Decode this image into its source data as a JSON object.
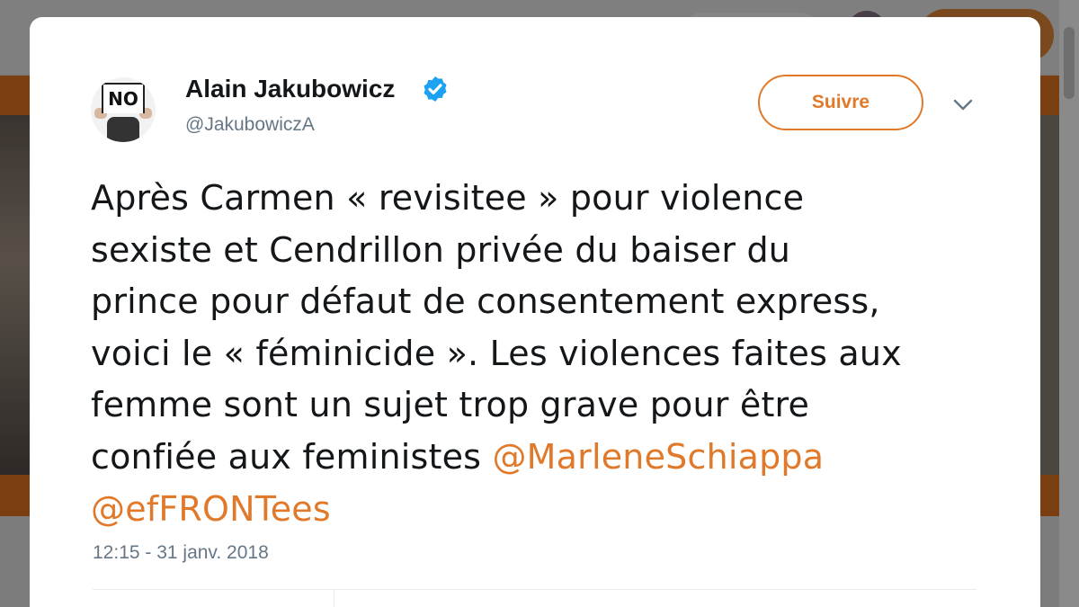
{
  "tweet": {
    "author": {
      "display_name": "Alain Jakubowicz",
      "handle": "@JakubowiczA",
      "verified": true,
      "avatar_sign_text": "NO"
    },
    "follow_button_label": "Suivre",
    "text_lines": [
      "Après Carmen « revisitee » pour violence",
      "sexiste et Cendrillon privée du baiser du",
      "prince pour défaut de consentement express,",
      "voici le « féminicide ». Les violences faites aux",
      "femme sont un sujet trop grave pour être",
      "confiée aux feministes "
    ],
    "mentions": [
      "@MarleneSchiappa",
      "@efFRONTees"
    ],
    "timestamp": "12:15 - 31 janv. 2018"
  },
  "colors": {
    "accent": "#e07a2a",
    "text": "#14171a",
    "secondary_text": "#657786",
    "verified_badge": "#1da1f2",
    "overlay": "#7b7b7b"
  },
  "icons": {
    "verified": "verified-badge-icon",
    "more": "chevron-down-icon"
  }
}
